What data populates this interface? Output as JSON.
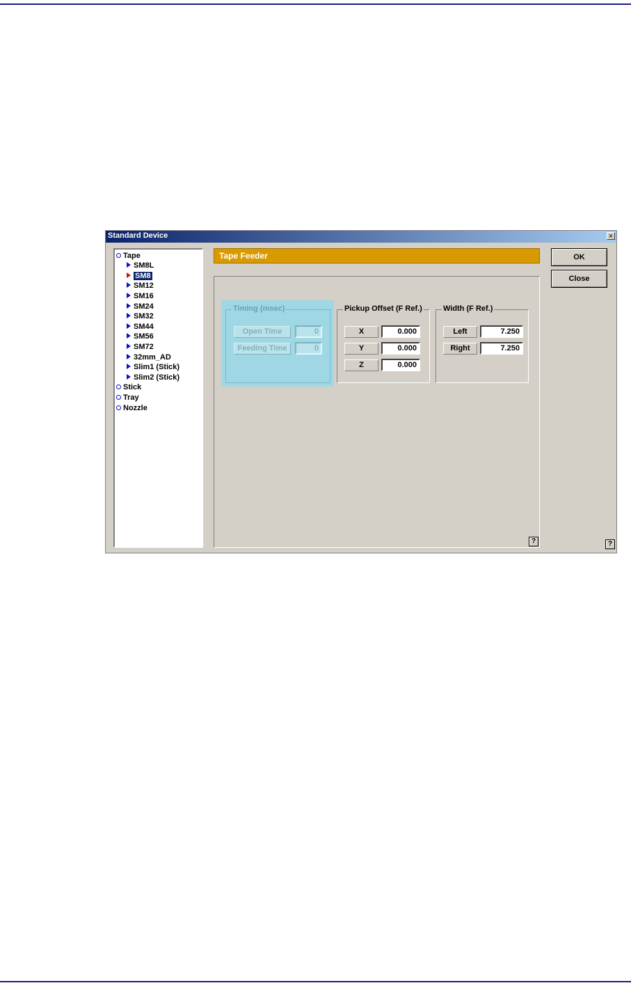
{
  "window": {
    "title": "Standard Device",
    "close_glyph": "×"
  },
  "tree": {
    "items": [
      {
        "label": "Tape",
        "level": 0
      },
      {
        "label": "SM8L",
        "level": 1
      },
      {
        "label": "SM8",
        "level": 1,
        "selected": true
      },
      {
        "label": "SM12",
        "level": 1
      },
      {
        "label": "SM16",
        "level": 1
      },
      {
        "label": "SM24",
        "level": 1
      },
      {
        "label": "SM32",
        "level": 1
      },
      {
        "label": "SM44",
        "level": 1
      },
      {
        "label": "SM56",
        "level": 1
      },
      {
        "label": "SM72",
        "level": 1
      },
      {
        "label": "32mm_AD",
        "level": 1
      },
      {
        "label": "Slim1 (Stick)",
        "level": 1
      },
      {
        "label": "Slim2 (Stick)",
        "level": 1
      },
      {
        "label": "Stick",
        "level": 0
      },
      {
        "label": "Tray",
        "level": 0
      },
      {
        "label": "Nozzle",
        "level": 0
      }
    ]
  },
  "header": {
    "title": "Tape Feeder"
  },
  "timing": {
    "title": "Timing (msec)",
    "open_time_label": "Open Time",
    "open_time_value": "0",
    "feeding_time_label": "Feeding Time",
    "feeding_time_value": "0"
  },
  "pickup": {
    "title": "Pickup Offset (F Ref.)",
    "x_label": "X",
    "x_value": "0.000",
    "y_label": "Y",
    "y_value": "0.000",
    "z_label": "Z",
    "z_value": "0.000"
  },
  "width": {
    "title": "Width (F Ref.)",
    "left_label": "Left",
    "left_value": "7.250",
    "right_label": "Right",
    "right_value": "7.250"
  },
  "buttons": {
    "ok": "OK",
    "close": "Close",
    "help": "?"
  },
  "colors": {
    "title_bar": "#0a246a",
    "header_bar": "#d99a00",
    "highlight": "#9fd8e4",
    "selection": "#0a246a"
  }
}
